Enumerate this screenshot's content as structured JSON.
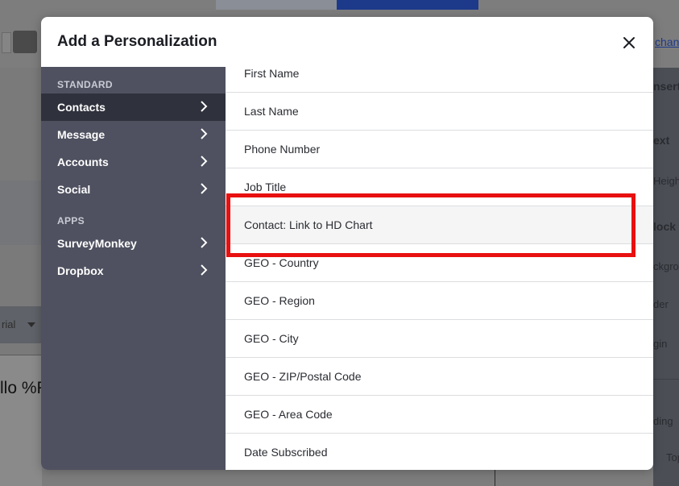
{
  "modal": {
    "title": "Add a Personalization",
    "close_icon": "close-icon"
  },
  "sidebar": {
    "sections": [
      {
        "label": "STANDARD",
        "items": [
          {
            "label": "Contacts",
            "active": true,
            "icon": "chevron-right-icon"
          },
          {
            "label": "Message",
            "active": false,
            "icon": "chevron-right-icon"
          },
          {
            "label": "Accounts",
            "active": false,
            "icon": "chevron-right-icon"
          },
          {
            "label": "Social",
            "active": false,
            "icon": "chevron-right-icon"
          }
        ]
      },
      {
        "label": "APPS",
        "items": [
          {
            "label": "SurveyMonkey",
            "active": false,
            "icon": "chevron-right-icon"
          },
          {
            "label": "Dropbox",
            "active": false,
            "icon": "chevron-right-icon"
          }
        ]
      }
    ]
  },
  "list": {
    "items": [
      {
        "label": "First Name"
      },
      {
        "label": "Last Name"
      },
      {
        "label": "Phone Number"
      },
      {
        "label": "Job Title"
      },
      {
        "label": "Contact: Link to HD Chart",
        "highlighted": true
      },
      {
        "label": "GEO - Country"
      },
      {
        "label": "GEO - Region"
      },
      {
        "label": "GEO - City"
      },
      {
        "label": "GEO - ZIP/Postal Code"
      },
      {
        "label": "GEO - Area Code"
      },
      {
        "label": "Date Subscribed"
      }
    ]
  },
  "background": {
    "font_select_value": "rial",
    "canvas_text": "llo %F",
    "right_link": "chan",
    "right_panel_labels": [
      "nsert",
      "ext",
      "Heigh",
      "lock",
      "ckgrou",
      "der",
      "gin",
      "ding",
      "Top"
    ]
  },
  "colors": {
    "sidebar_bg": "#4f5160",
    "sidebar_active": "#2f313c",
    "highlight_border": "#e81010",
    "overlay": "#7d7d7d"
  }
}
